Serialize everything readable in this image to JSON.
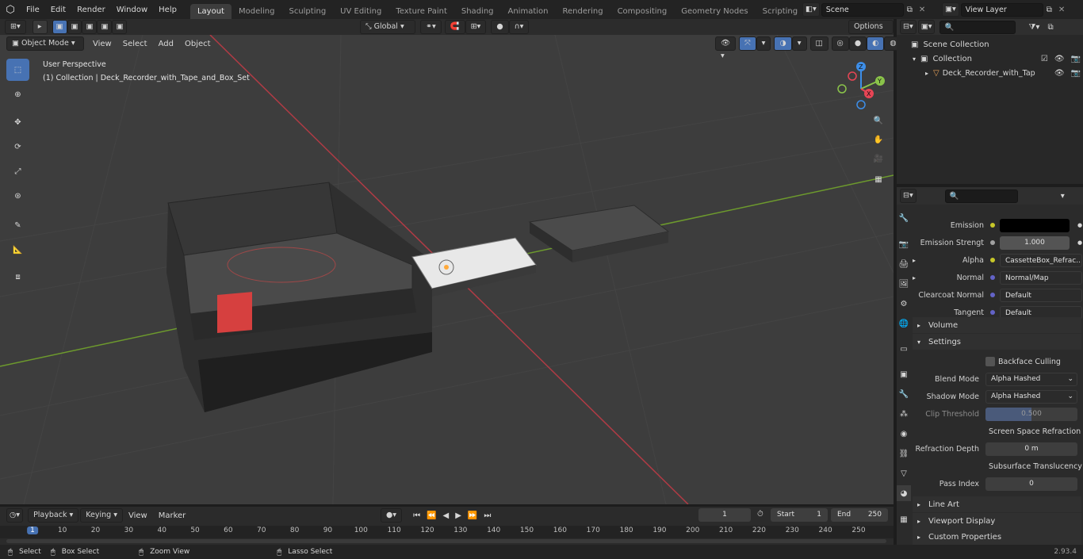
{
  "menus": [
    "File",
    "Edit",
    "Render",
    "Window",
    "Help"
  ],
  "workspaces": [
    "Layout",
    "Modeling",
    "Sculpting",
    "UV Editing",
    "Texture Paint",
    "Shading",
    "Animation",
    "Rendering",
    "Compositing",
    "Geometry Nodes",
    "Scripting"
  ],
  "scene_field": "Scene",
  "view_layer_field": "View Layer",
  "toolbar": {
    "orientation": "Global",
    "options": "Options"
  },
  "vp_header": {
    "mode": "Object Mode",
    "view": "View",
    "select": "Select",
    "add": "Add",
    "object": "Object"
  },
  "viewport_info": {
    "line1": "User Perspective",
    "line2": "(1) Collection | Deck_Recorder_with_Tape_and_Box_Set"
  },
  "outliner": {
    "scene_collection": "Scene Collection",
    "collection": "Collection",
    "object": "Deck_Recorder_with_Tap"
  },
  "props": {
    "emission": "Emission",
    "emission_strength_label": "Emission Strengt",
    "emission_strength_value": "1.000",
    "alpha_label": "Alpha",
    "alpha_value": "CassetteBox_Refrac...",
    "normal_label": "Normal",
    "normal_value": "Normal/Map",
    "clearcoat_label": "Clearcoat Normal",
    "clearcoat_value": "Default",
    "tangent_label": "Tangent",
    "tangent_value": "Default",
    "volume": "Volume",
    "settings": "Settings",
    "backface": "Backface Culling",
    "blend_label": "Blend Mode",
    "blend_value": "Alpha Hashed",
    "shadow_label": "Shadow Mode",
    "shadow_value": "Alpha Hashed",
    "clip_label": "Clip Threshold",
    "clip_value": "0.500",
    "ssr": "Screen Space Refraction",
    "refr_label": "Refraction Depth",
    "refr_value": "0 m",
    "sss": "Subsurface Translucency",
    "pass_label": "Pass Index",
    "pass_value": "0",
    "line_art": "Line Art",
    "viewport_display": "Viewport Display",
    "custom_props": "Custom Properties"
  },
  "timeline": {
    "playback": "Playback",
    "keying": "Keying",
    "view": "View",
    "marker": "Marker",
    "current_frame": "1",
    "start_label": "Start",
    "start_value": "1",
    "end_label": "End",
    "end_value": "250",
    "ticks": [
      "1",
      "10",
      "20",
      "30",
      "40",
      "50",
      "60",
      "70",
      "80",
      "90",
      "100",
      "110",
      "120",
      "130",
      "140",
      "150",
      "160",
      "170",
      "180",
      "190",
      "200",
      "210",
      "220",
      "230",
      "240",
      "250"
    ]
  },
  "status": {
    "select": "Select",
    "box_select": "Box Select",
    "zoom_view": "Zoom View",
    "lasso_select": "Lasso Select",
    "version": "2.93.4"
  },
  "colors": {
    "accent": "#4772b3",
    "x_axis": "#e84555",
    "y_axis": "#8ac34a",
    "z_axis": "#3d8ee8"
  }
}
